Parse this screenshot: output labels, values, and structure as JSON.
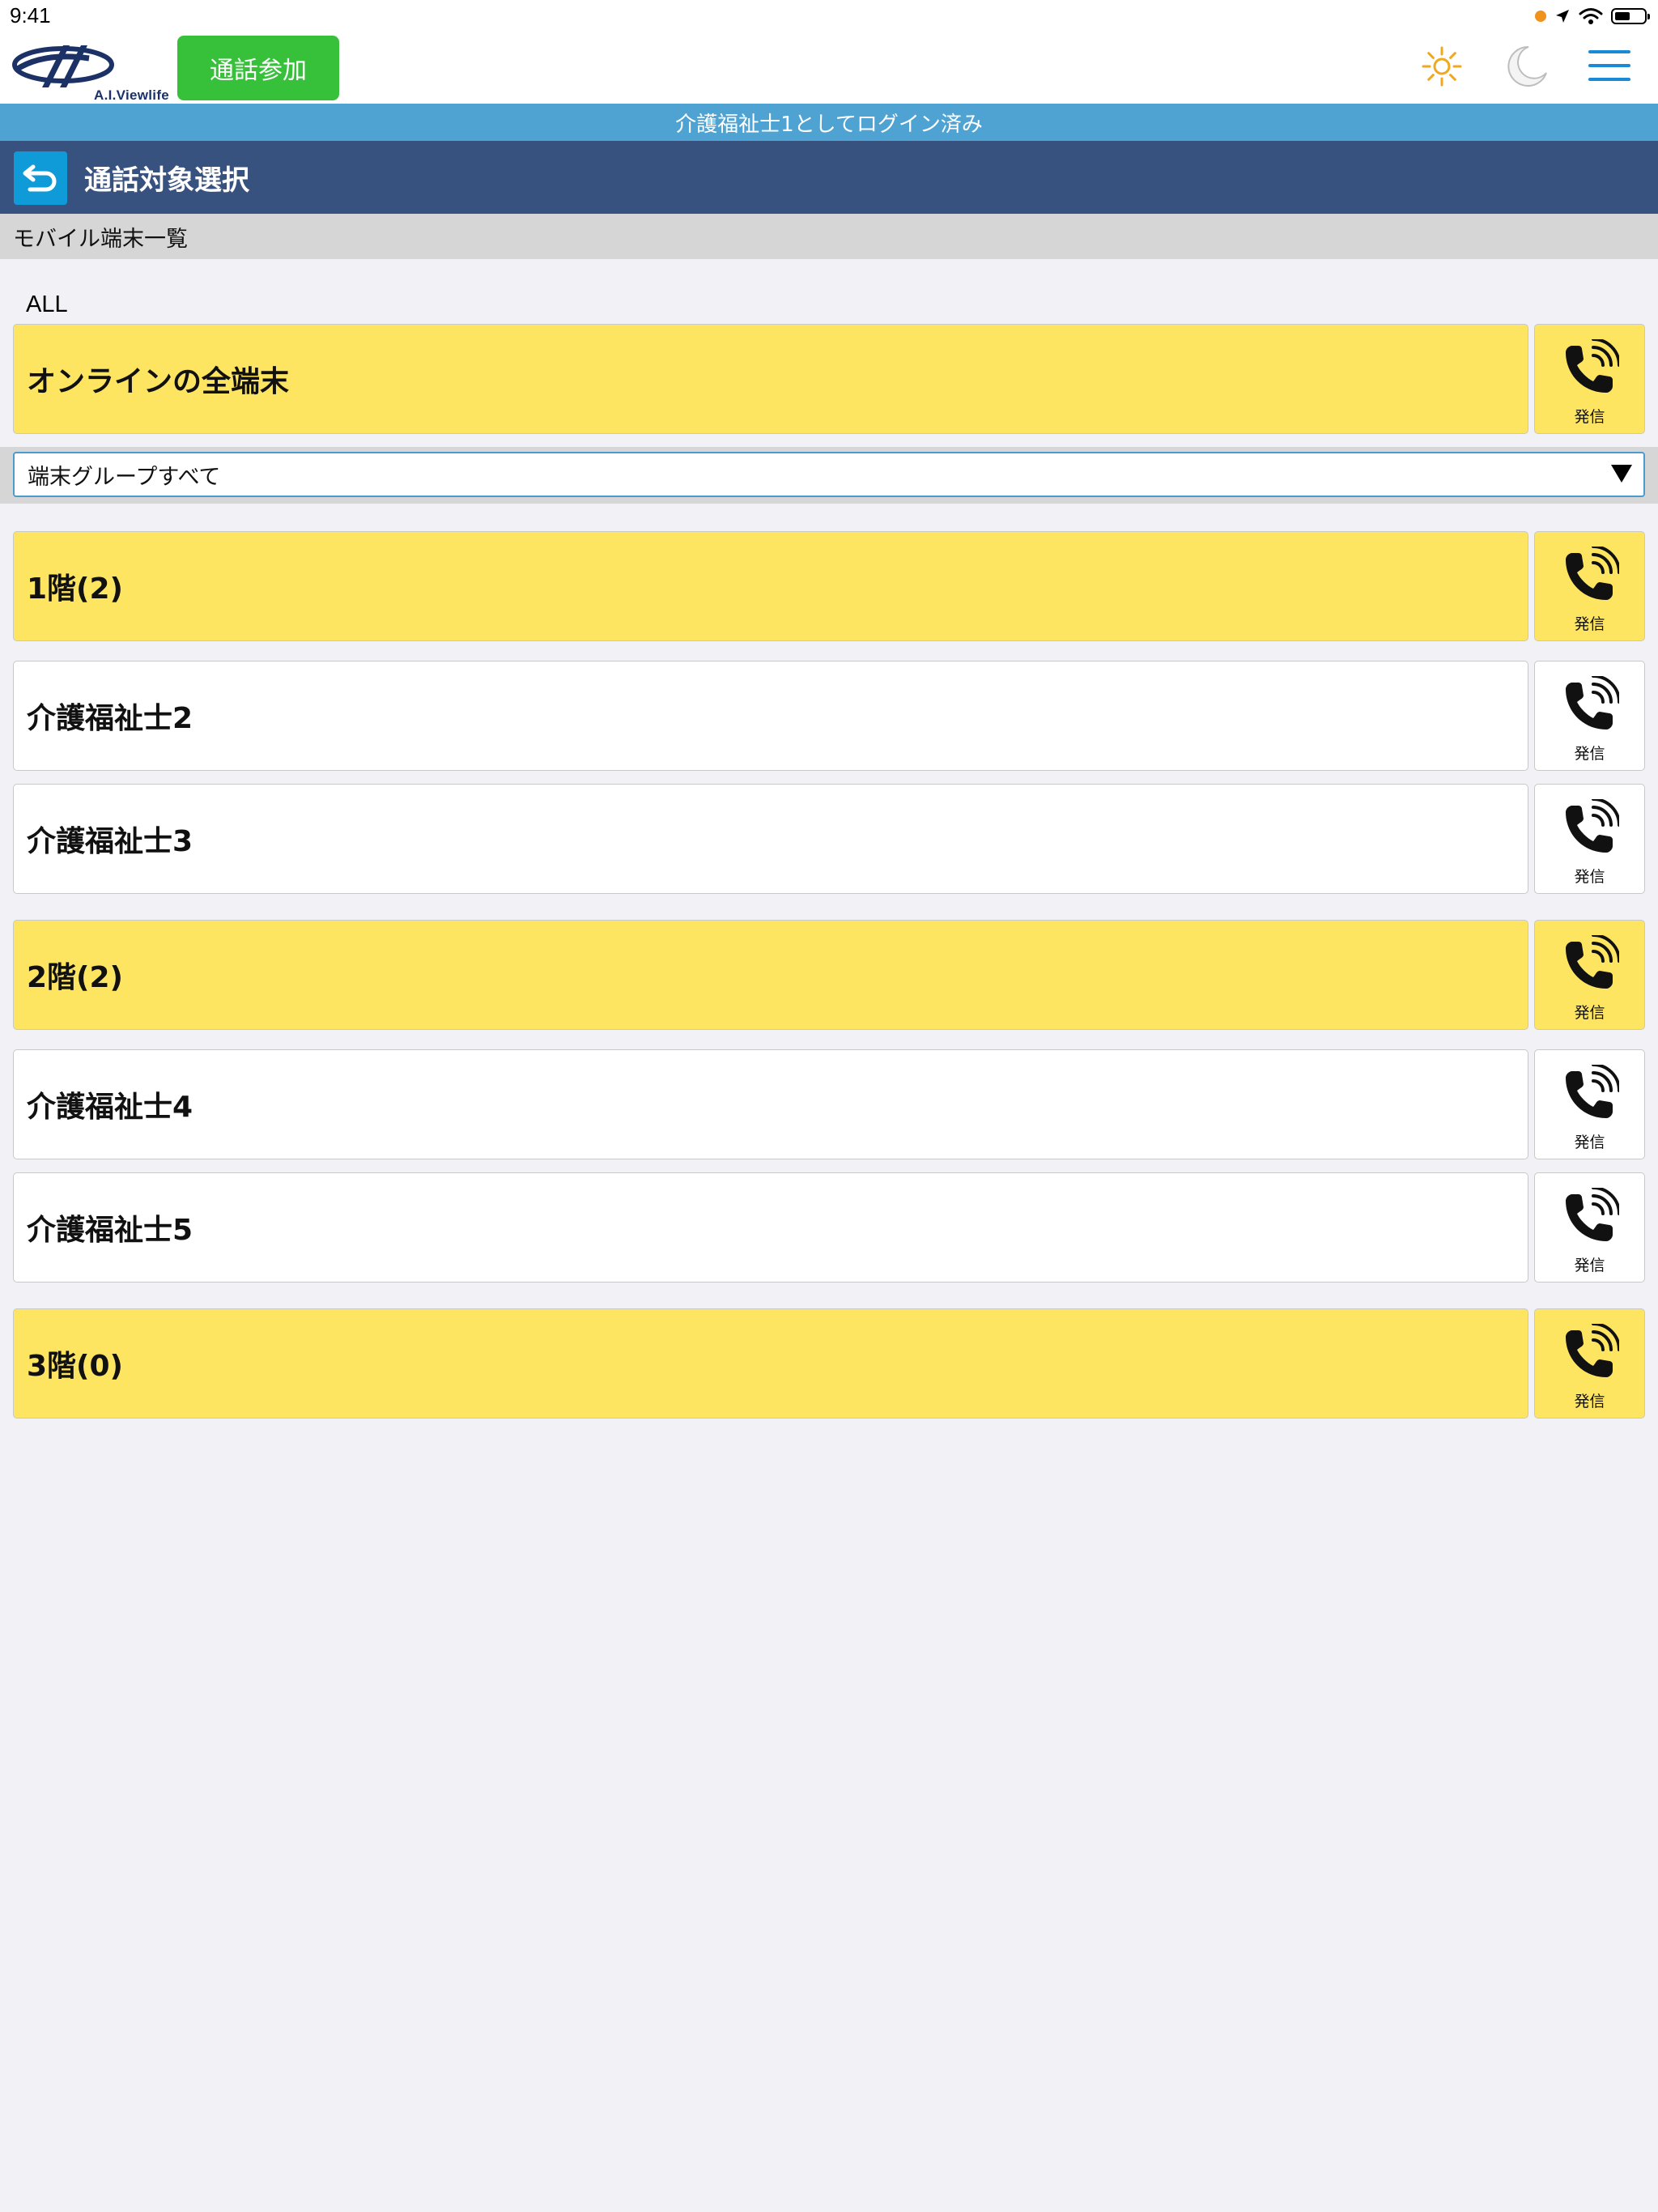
{
  "status_bar": {
    "time": "9:41"
  },
  "header": {
    "logo_text": "A.I.Viewlife",
    "join_button": "通話参加",
    "colors": {
      "join_button": "#37c03a",
      "logo": "#1c3266",
      "menu": "#1a8ad6",
      "sun": "#f0a81e"
    },
    "icons": [
      "sun-icon",
      "moon-icon",
      "menu-icon"
    ]
  },
  "login_banner": "介護福祉士1としてログイン済み",
  "title_bar": {
    "title": "通話対象選択",
    "back_icon": "back-icon"
  },
  "section_title": "モバイル端末一覧",
  "all_label": "ALL",
  "all_row": {
    "label": "オンラインの全端末",
    "call_label": "発信"
  },
  "group_select": {
    "selected": "端末グループすべて"
  },
  "rows": [
    {
      "label": "1階(2)",
      "type": "group",
      "call_label": "発信"
    },
    {
      "label": "介護福祉士2",
      "type": "device",
      "call_label": "発信"
    },
    {
      "label": "介護福祉士3",
      "type": "device",
      "call_label": "発信"
    },
    {
      "label": "2階(2)",
      "type": "group",
      "call_label": "発信"
    },
    {
      "label": "介護福祉士4",
      "type": "device",
      "call_label": "発信"
    },
    {
      "label": "介護福祉士5",
      "type": "device",
      "call_label": "発信"
    },
    {
      "label": "3階(0)",
      "type": "group",
      "call_label": "発信"
    }
  ],
  "colors": {
    "group_row": "#fde562",
    "device_row": "#ffffff",
    "title_bar": "#38527f",
    "login_banner": "#4ea3d2",
    "back_button": "#0e9bd8",
    "background": "#f1f1f6"
  }
}
